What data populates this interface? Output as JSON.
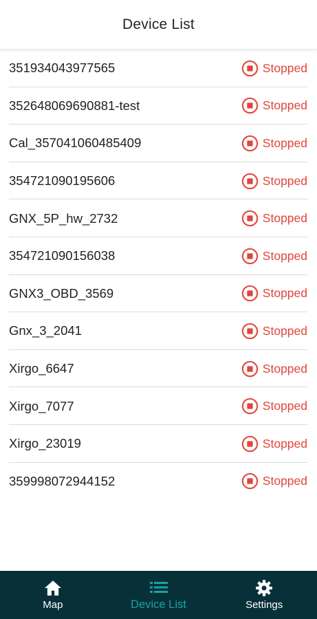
{
  "header": {
    "title": "Device List"
  },
  "devices": [
    {
      "name": "351934043977565",
      "status": "Stopped"
    },
    {
      "name": "352648069690881-test",
      "status": "Stopped"
    },
    {
      "name": "Cal_357041060485409",
      "status": "Stopped"
    },
    {
      "name": "354721090195606",
      "status": "Stopped"
    },
    {
      "name": "GNX_5P_hw_2732",
      "status": "Stopped"
    },
    {
      "name": "354721090156038",
      "status": "Stopped"
    },
    {
      "name": "GNX3_OBD_3569",
      "status": "Stopped"
    },
    {
      "name": "Gnx_3_2041",
      "status": "Stopped"
    },
    {
      "name": "Xirgo_6647",
      "status": "Stopped"
    },
    {
      "name": "Xirgo_7077",
      "status": "Stopped"
    },
    {
      "name": "Xirgo_23019",
      "status": "Stopped"
    },
    {
      "name": "359998072944152",
      "status": "Stopped"
    }
  ],
  "nav": {
    "items": [
      {
        "label": "Map",
        "icon": "home-icon"
      },
      {
        "label": "Device List",
        "icon": "list-icon",
        "active": true
      },
      {
        "label": "Settings",
        "icon": "gear-icon"
      }
    ]
  },
  "colors": {
    "status_stopped": "#e2453c",
    "nav_background": "#083039",
    "nav_active": "#1aa3a3"
  }
}
